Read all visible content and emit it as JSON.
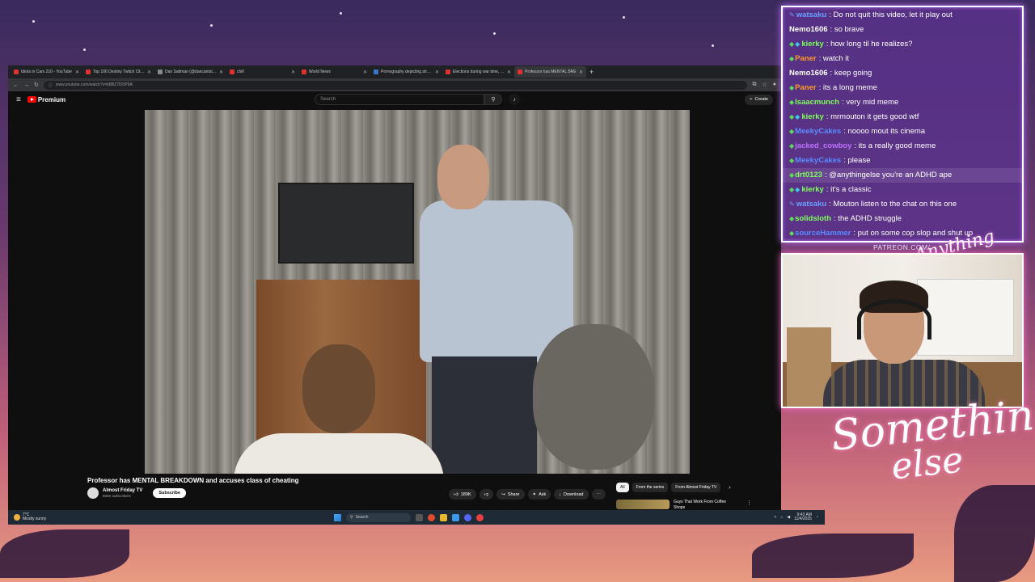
{
  "browser": {
    "tabs": [
      {
        "label": "Idiots in Cars 210 - YouTube",
        "favicon": "youtube-icon"
      },
      {
        "label": "Top 100 Destiny Twitch Clips - \\",
        "favicon": "youtube-icon"
      },
      {
        "label": "Dan Saltman (@dancantstream -",
        "favicon": "x-icon"
      },
      {
        "label": "chill",
        "favicon": "youtube-icon"
      },
      {
        "label": "World News",
        "favicon": "reddit-icon"
      },
      {
        "label": "Pornography depicting strangu",
        "favicon": "wikipedia-icon"
      },
      {
        "label": "Elections during war time, how",
        "favicon": "reddit-icon"
      },
      {
        "label": "Professor has MENTAL BRE",
        "favicon": "youtube-icon",
        "active": true
      }
    ],
    "url": "www.youtube.com/watch?v=b8BZ7DOP9A"
  },
  "youtube": {
    "logo_text": "Premium",
    "search_placeholder": "Search",
    "create_label": "Create",
    "video": {
      "title": "Professor has MENTAL BREAKDOWN and accuses class of cheating",
      "channel": "Almost Friday TV",
      "subscribers": "865K subscribers",
      "subscribe_label": "Subscribe",
      "likes": "189K",
      "share_label": "Share",
      "ask_label": "Ask",
      "download_label": "Download"
    },
    "chips": [
      "All",
      "From the series",
      "From Almost Friday TV"
    ],
    "recommendation": {
      "title": "Guys That Work From Coffee Shops"
    }
  },
  "taskbar": {
    "temperature": "7°C",
    "weather": "Mostly sunny",
    "search_label": "Search",
    "time": "9:43 AM",
    "date": "11/4/2025"
  },
  "chat": {
    "messages": [
      {
        "user": "watsaku",
        "color": "#6aa0ff",
        "badges": [
          "pen"
        ],
        "text": "Do not quit this video, let it play out"
      },
      {
        "user": "Nemo1606",
        "color": "#ffffff",
        "badges": [],
        "text": "so brave"
      },
      {
        "user": "kierky",
        "color": "#7dff5a",
        "badges": [
          "sub",
          "gem"
        ],
        "text": "how long til he realizes?"
      },
      {
        "user": "Paner",
        "color": "#ff9a2a",
        "badges": [
          "sub"
        ],
        "text": "watch it"
      },
      {
        "user": "Nemo1606",
        "color": "#ffffff",
        "badges": [],
        "text": "keep going"
      },
      {
        "user": "Paner",
        "color": "#ff9a2a",
        "badges": [
          "sub"
        ],
        "text": "its a long meme"
      },
      {
        "user": "Isaacmunch",
        "color": "#7dff5a",
        "badges": [
          "sub"
        ],
        "text": "very mid meme"
      },
      {
        "user": "kierky",
        "color": "#7dff5a",
        "badges": [
          "sub",
          "gem"
        ],
        "text": "mrmouton it gets good wtf"
      },
      {
        "user": "MeekyCakes",
        "color": "#5a8cff",
        "badges": [
          "sub"
        ],
        "text": "noooo mout its cinema"
      },
      {
        "user": "jacked_cowboy",
        "color": "#c070ff",
        "badges": [
          "sub"
        ],
        "text": "its a really good meme"
      },
      {
        "user": "MeekyCakes",
        "color": "#5a8cff",
        "badges": [
          "sub"
        ],
        "text": "please"
      },
      {
        "user": "drt0123",
        "color": "#7dff5a",
        "badges": [
          "sub"
        ],
        "text": "@anythingelse you're an ADHD ape",
        "highlight": true
      },
      {
        "user": "kierky",
        "color": "#7dff5a",
        "badges": [
          "sub",
          "gem"
        ],
        "text": "it's a classic"
      },
      {
        "user": "watsaku",
        "color": "#6aa0ff",
        "badges": [
          "pen"
        ],
        "text": "Mouton listen to the chat on this one"
      },
      {
        "user": "solidsloth",
        "color": "#7dff5a",
        "badges": [
          "sub"
        ],
        "text": "the ADHD struggle"
      },
      {
        "user": "sourceHammer",
        "color": "#5a8cff",
        "badges": [
          "sub"
        ],
        "text": "put on some cop slop and shut up"
      }
    ]
  },
  "overlay": {
    "patreon_text": "PATREON.COM/",
    "brand_small": "Anything Else",
    "brand_big_line1": "Something",
    "brand_big_line2": "else"
  }
}
